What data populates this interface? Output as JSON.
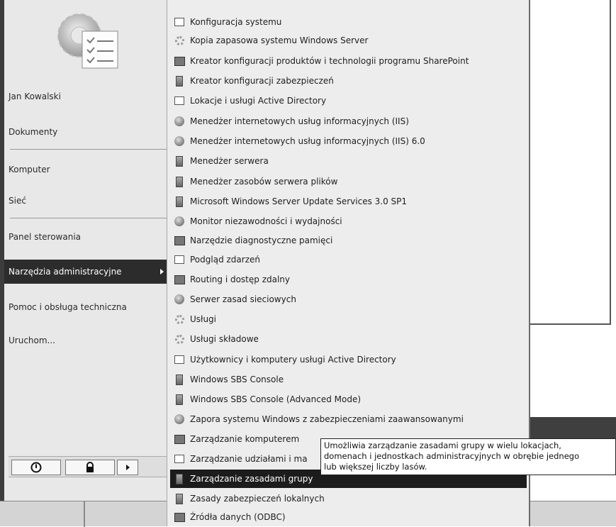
{
  "left_pane": {
    "user_name": "Jan Kowalski",
    "items": [
      {
        "label": "Dokumenty"
      },
      {
        "label": "Komputer"
      },
      {
        "label": "Sieć"
      },
      {
        "label": "Panel sterowania"
      },
      {
        "label": "Narzędzia administracyjne",
        "selected": true
      },
      {
        "label": "Pomoc i obsługa techniczna"
      },
      {
        "label": "Uruchom..."
      }
    ],
    "power_icons": [
      "power-icon",
      "lock-icon",
      "arrow-right-icon"
    ]
  },
  "submenu": {
    "items": [
      {
        "label": "Konfiguracja systemu",
        "icon": "system-config-icon"
      },
      {
        "label": "Kopia zapasowa systemu Windows Server",
        "icon": "backup-icon"
      },
      {
        "label": "Kreator konfiguracji produktów i technologii programu SharePoint",
        "icon": "sharepoint-icon"
      },
      {
        "label": "Kreator konfiguracji zabezpieczeń",
        "icon": "security-wizard-icon"
      },
      {
        "label": "Lokacje i usługi Active Directory",
        "icon": "ad-sites-icon"
      },
      {
        "label": "Menedżer internetowych usług informacyjnych (IIS)",
        "icon": "iis-icon"
      },
      {
        "label": "Menedżer internetowych usług informacyjnych (IIS) 6.0",
        "icon": "iis6-icon"
      },
      {
        "label": "Menedżer serwera",
        "icon": "server-manager-icon"
      },
      {
        "label": "Menedżer zasobów serwera plików",
        "icon": "file-server-icon"
      },
      {
        "label": "Microsoft Windows Server Update Services 3.0 SP1",
        "icon": "wsus-icon"
      },
      {
        "label": "Monitor niezawodności i wydajności",
        "icon": "monitor-icon"
      },
      {
        "label": "Narzędzie diagnostyczne pamięci",
        "icon": "memory-diagnostic-icon"
      },
      {
        "label": "Podgląd zdarzeń",
        "icon": "event-viewer-icon"
      },
      {
        "label": "Routing i dostęp zdalny",
        "icon": "routing-icon"
      },
      {
        "label": "Serwer zasad sieciowych",
        "icon": "network-policy-icon"
      },
      {
        "label": "Usługi",
        "icon": "services-icon"
      },
      {
        "label": "Usługi składowe",
        "icon": "component-services-icon"
      },
      {
        "label": "Użytkownicy i komputery usługi Active Directory",
        "icon": "ad-users-icon"
      },
      {
        "label": "Windows SBS Console",
        "icon": "sbs-console-icon"
      },
      {
        "label": "Windows SBS Console (Advanced Mode)",
        "icon": "sbs-console-advanced-icon"
      },
      {
        "label": "Zapora systemu Windows z zabezpieczeniami zaawansowanymi",
        "icon": "firewall-icon"
      },
      {
        "label": "Zarządzanie komputerem",
        "icon": "computer-management-icon"
      },
      {
        "label": "Zarządzanie udziałami i ma",
        "icon": "share-management-icon"
      },
      {
        "label": "Zarządzanie zasadami grupy",
        "icon": "group-policy-icon",
        "highlighted": true
      },
      {
        "label": "Zasady zabezpieczeń lokalnych",
        "icon": "local-security-icon"
      },
      {
        "label": "Źródła danych (ODBC)",
        "icon": "odbc-icon"
      }
    ]
  },
  "tooltip": {
    "lines": [
      "Umożliwia zarządzanie zasadami grupy w wielu lokacjach,",
      "domenach i jednostkach administracyjnych w obrębie jednego",
      "lub większej liczby lasów."
    ]
  }
}
